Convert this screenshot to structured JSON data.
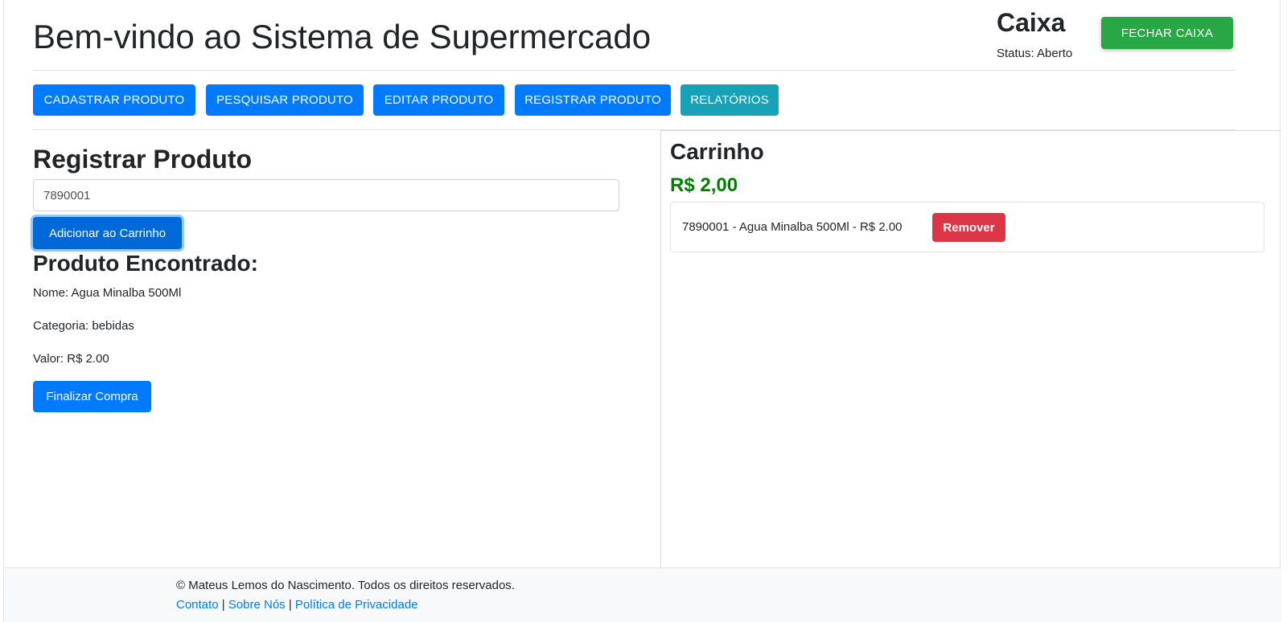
{
  "header": {
    "title": "Bem-vindo ao Sistema de Supermercado",
    "caixa": {
      "title": "Caixa",
      "status": "Status: Aberto",
      "close_button": "FECHAR CAIXA"
    }
  },
  "nav": {
    "items": [
      {
        "label": "CADASTRAR PRODUTO"
      },
      {
        "label": "PESQUISAR PRODUTO"
      },
      {
        "label": "EDITAR PRODUTO"
      },
      {
        "label": "REGISTRAR PRODUTO"
      },
      {
        "label": "RELATÓRIOS"
      }
    ]
  },
  "register": {
    "title": "Registrar Produto",
    "input_value": "7890001",
    "add_button": "Adicionar ao Carrinho",
    "found_title": "Produto Encontrado:",
    "name_line": "Nome: Agua Minalba 500Ml",
    "category_line": "Categoria: bebidas",
    "value_line": "Valor: R$ 2.00",
    "finish_button": "Finalizar Compra"
  },
  "cart": {
    "title": "Carrinho",
    "total": "R$ 2,00",
    "items": [
      {
        "text": "7890001 - Agua Minalba 500Ml - R$ 2.00",
        "remove_label": "Remover"
      }
    ]
  },
  "footer": {
    "copyright": "© Mateus Lemos do Nascimento. Todos os direitos reservados.",
    "links": [
      "Contato",
      "Sobre Nós",
      "Política de Privacidade"
    ],
    "separator": "|"
  },
  "colors": {
    "primary": "#007bff",
    "success": "#28a745",
    "info": "#17a2b8",
    "danger": "#dc3545",
    "total_green": "#008000"
  }
}
